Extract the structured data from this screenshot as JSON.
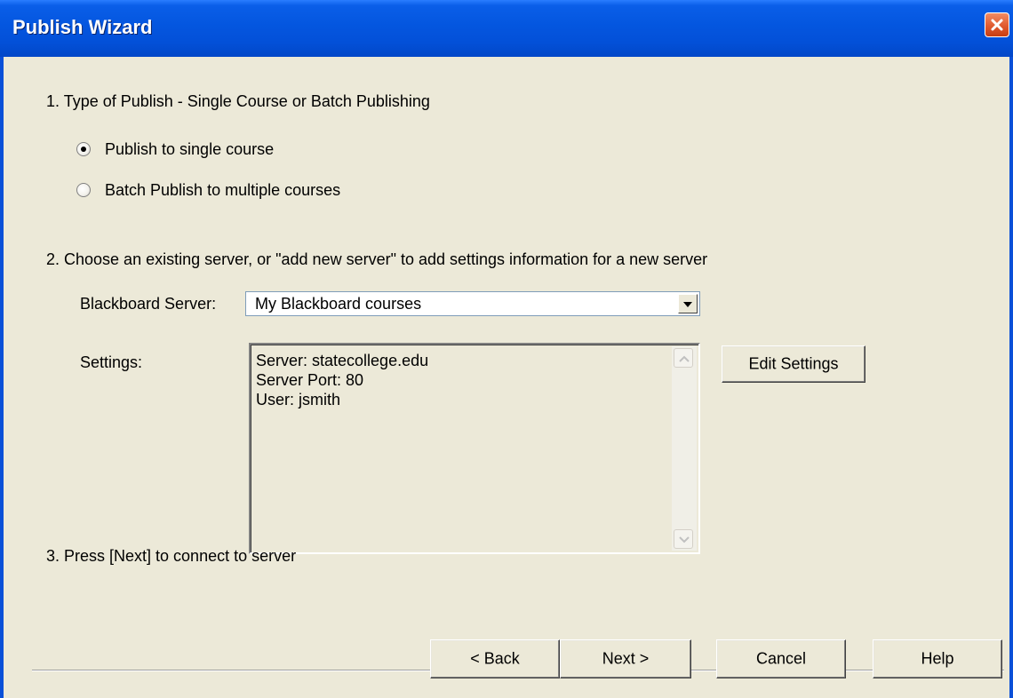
{
  "window": {
    "title": "Publish Wizard",
    "close_icon": "close-icon"
  },
  "step1": {
    "heading": "1.  Type of Publish - Single Course or Batch Publishing",
    "options": [
      {
        "label": "Publish to single course",
        "selected": true
      },
      {
        "label": "Batch Publish to multiple courses",
        "selected": false
      }
    ]
  },
  "step2": {
    "heading": "2.  Choose an existing server, or \"add new server\" to add settings information for a new server",
    "server_label": "Blackboard Server:",
    "server_value": "My Blackboard courses",
    "settings_label": "Settings:",
    "settings_lines": [
      "Server: statecollege.edu",
      "Server Port: 80",
      "User: jsmith"
    ],
    "edit_button": "Edit Settings"
  },
  "step3": {
    "heading": "3.  Press [Next] to connect to server"
  },
  "footer": {
    "back": "< Back",
    "next": "Next >",
    "cancel": "Cancel",
    "help": "Help"
  }
}
